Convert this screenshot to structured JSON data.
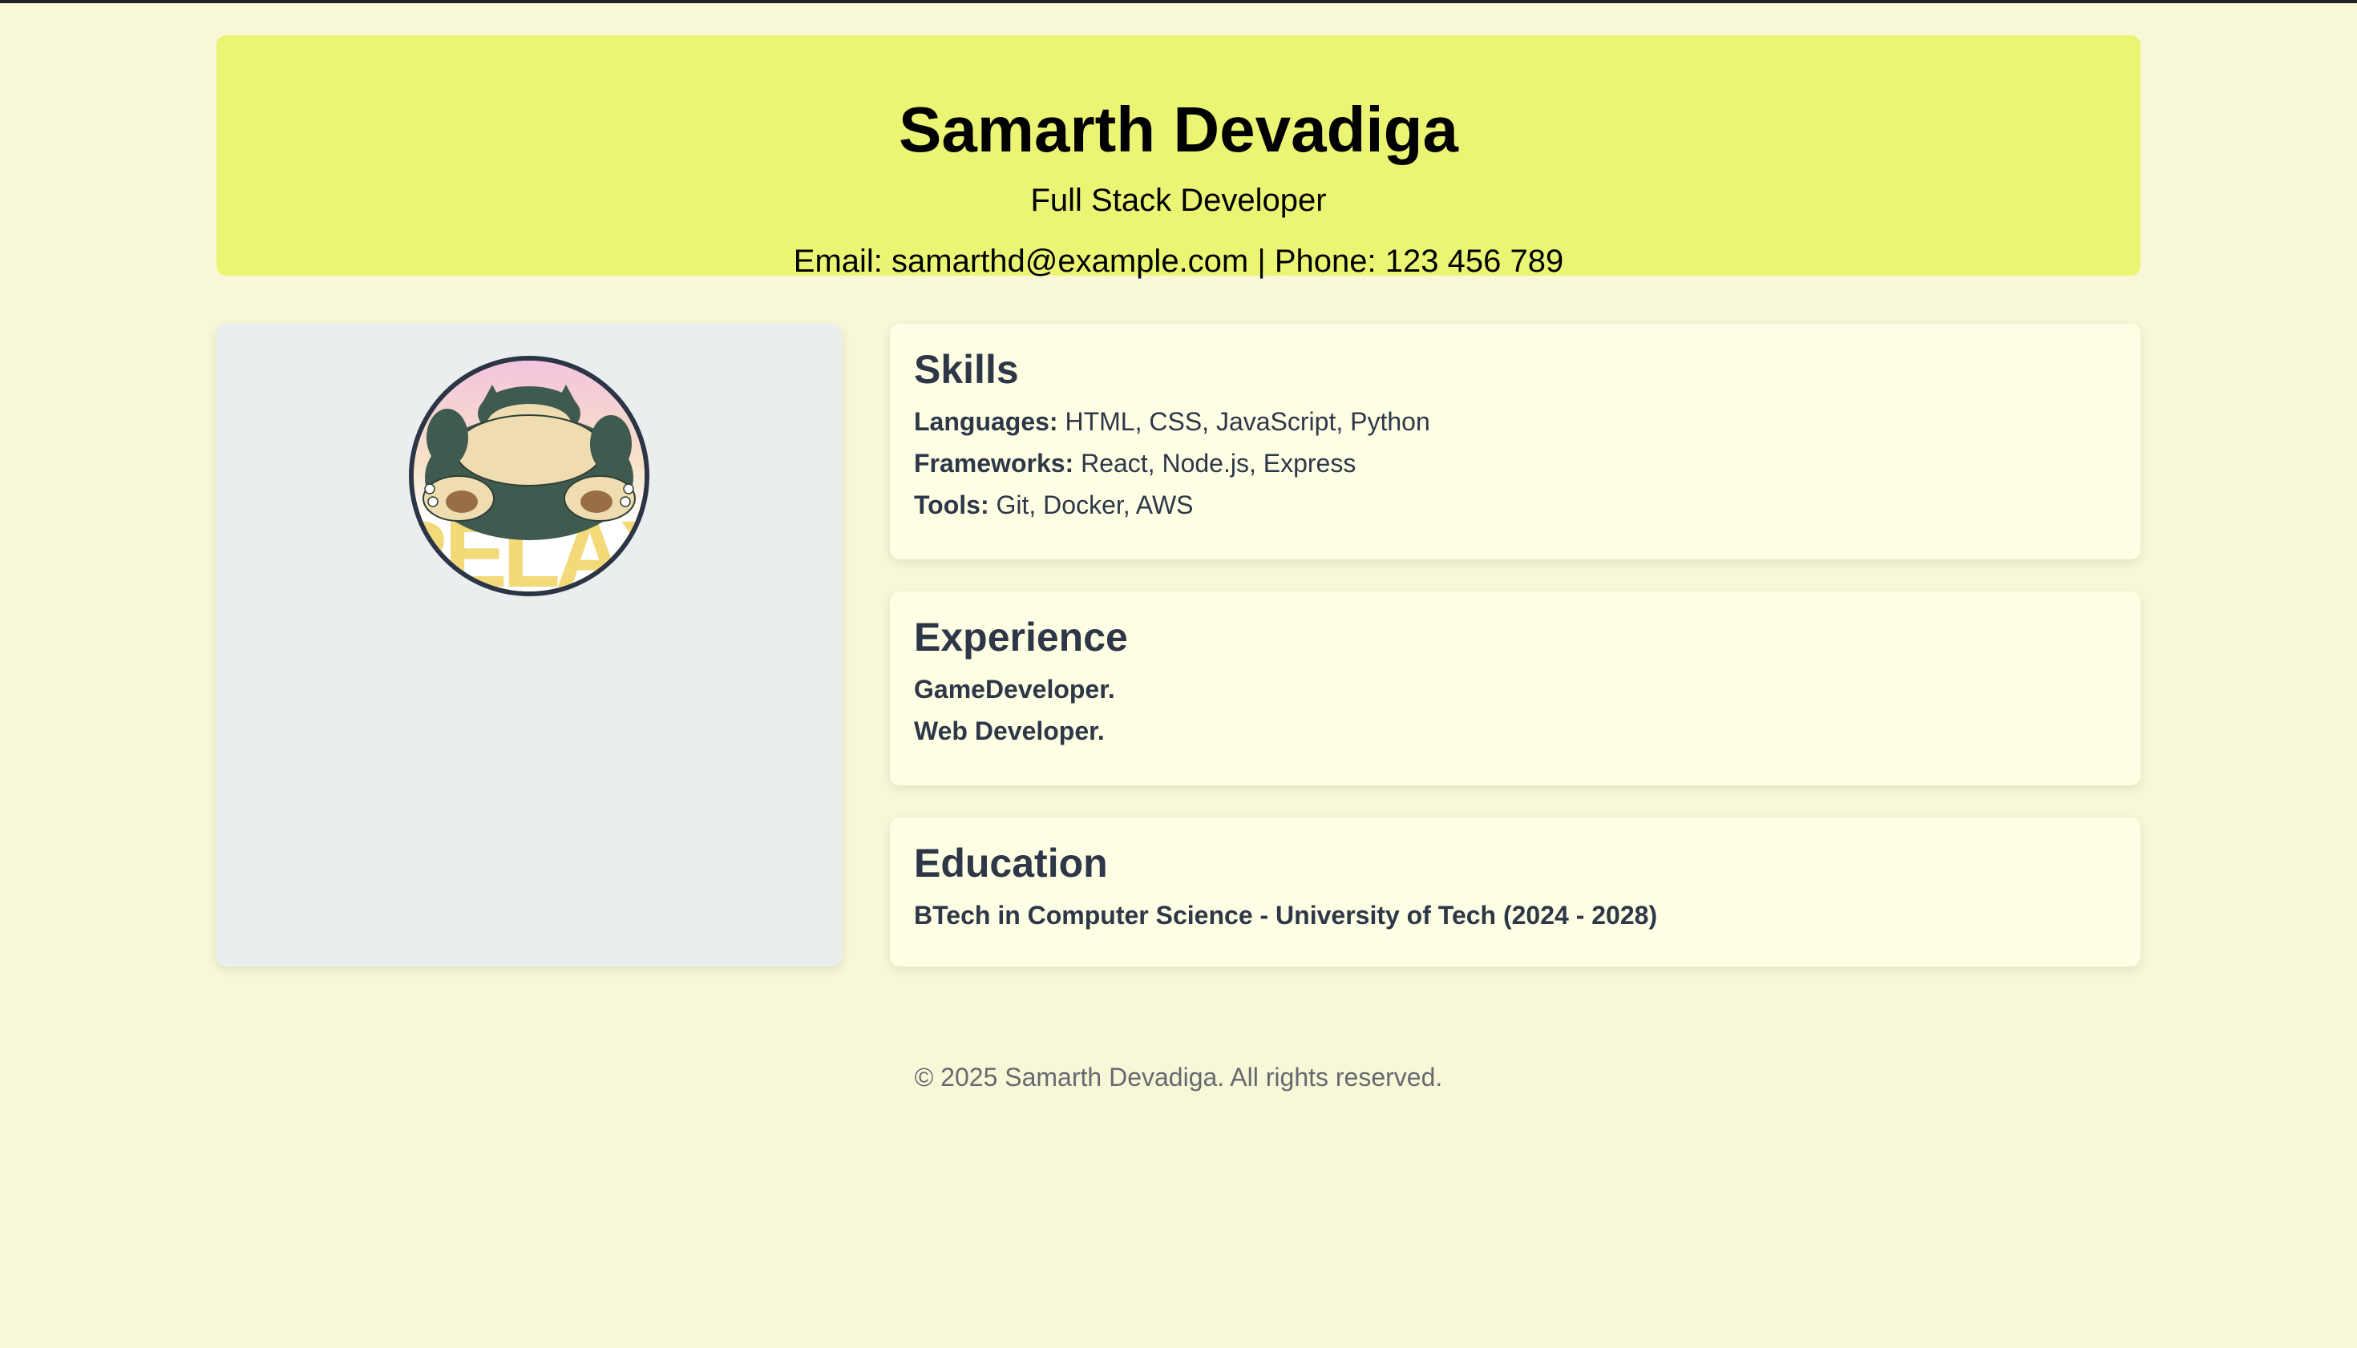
{
  "header": {
    "name": "Samarth Devadiga",
    "title": "Full Stack Developer",
    "contact": "Email: samarthd@example.com | Phone: 123 456 789"
  },
  "profile": {
    "avatar_icon": "snorlax-avatar-icon",
    "avatar_overlay_text": "RELAX"
  },
  "skills": {
    "heading": "Skills",
    "items": [
      {
        "label": "Languages:",
        "value": " HTML, CSS, JavaScript, Python"
      },
      {
        "label": "Frameworks:",
        "value": " React, Node.js, Express"
      },
      {
        "label": "Tools:",
        "value": " Git, Docker, AWS"
      }
    ]
  },
  "experience": {
    "heading": "Experience",
    "items": [
      "GameDeveloper.",
      "Web Developer."
    ]
  },
  "education": {
    "heading": "Education",
    "items": [
      "BTech in Computer Science - University of Tech (2024 - 2028)"
    ]
  },
  "footer": {
    "text": "© 2025 Samarth Devadiga. All rights reserved."
  },
  "colors": {
    "page_bg": "#f8f8d8",
    "header_bg": "#ebf574",
    "card_bg": "#fefee4",
    "profile_bg": "#ebeeee",
    "heading_text": "#2d3748"
  }
}
